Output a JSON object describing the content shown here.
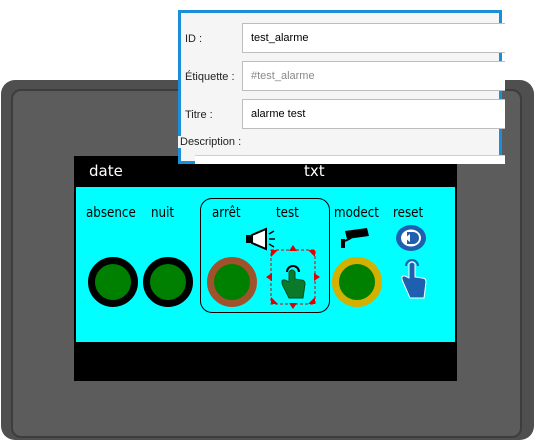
{
  "screen": {
    "date_label": "date",
    "txt_label": "txt",
    "indicators": [
      {
        "label": "absence",
        "ring": "#000000",
        "fill": "#008000"
      },
      {
        "label": "nuit",
        "ring": "#000000",
        "fill": "#008000"
      },
      {
        "label": "arrêt",
        "ring": "#a0522d",
        "fill": "#008000"
      },
      {
        "label": "test",
        "fill": "#008000"
      },
      {
        "label": "modect",
        "ring": "#d4b000",
        "fill": "#008000"
      },
      {
        "label": "reset"
      }
    ],
    "colors": {
      "panel": "#00ffff",
      "frame": "#4f4f4f",
      "accent": "#1a8fd8"
    }
  },
  "properties": {
    "id_label": "ID :",
    "id_value": "test_alarme",
    "etiquette_label": "Étiquette :",
    "etiquette_placeholder": "#test_alarme",
    "titre_label": "Titre :",
    "titre_value": "alarme test",
    "description_label": "Description :"
  }
}
